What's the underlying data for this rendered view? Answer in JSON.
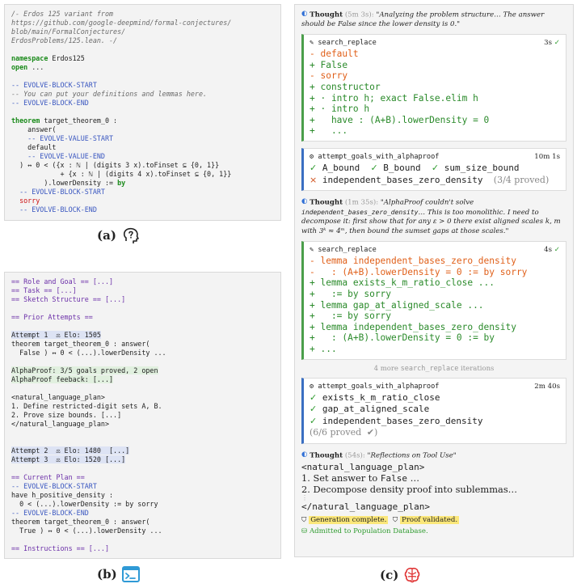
{
  "panel_a": {
    "lines": [
      {
        "cls": "comment",
        "text": "/- Erdos 125 variant from"
      },
      {
        "cls": "comment",
        "text": "https://github.com/google-deepmind/formal-conjectures/"
      },
      {
        "cls": "comment",
        "text": "blob/main/FormalConjectures/"
      },
      {
        "cls": "comment",
        "text": "ErdosProblems/125.lean. -/"
      },
      {
        "cls": "",
        "text": ""
      },
      {
        "cls": "kw-line",
        "kw": "namespace",
        "text": " Erdos125"
      },
      {
        "cls": "kw-line",
        "kw": "open",
        "text": " ..."
      },
      {
        "cls": "",
        "text": ""
      },
      {
        "cls": "evolve",
        "text": "-- EVOLVE-BLOCK-START"
      },
      {
        "cls": "comment",
        "text": "-- You can put your definitions and lemmas here."
      },
      {
        "cls": "evolve",
        "text": "-- EVOLVE-BLOCK-END"
      },
      {
        "cls": "",
        "text": ""
      },
      {
        "cls": "kw-line",
        "kw": "theorem",
        "text": " target_theorem_0 :"
      },
      {
        "cls": "",
        "text": "    answer("
      },
      {
        "cls": "evolve",
        "text": "    -- EVOLVE-VALUE-START"
      },
      {
        "cls": "",
        "text": "    default"
      },
      {
        "cls": "evolve",
        "text": "    -- EVOLVE-VALUE-END"
      },
      {
        "cls": "",
        "text": "  ) ↔ 0 < ({x : ℕ | (digits 3 x).toFinset ⊆ {0, 1}}"
      },
      {
        "cls": "",
        "text": "            + {x : ℕ | (digits 4 x).toFinset ⊆ {0, 1}}"
      },
      {
        "cls": "kw-tail",
        "text": "        ).lowerDensity := ",
        "kw": "by"
      },
      {
        "cls": "evolve",
        "text": "  -- EVOLVE-BLOCK-START"
      },
      {
        "cls": "red",
        "text": "  sorry"
      },
      {
        "cls": "evolve",
        "text": "  -- EVOLVE-BLOCK-END"
      }
    ]
  },
  "caption_a": "(a)",
  "panel_b": {
    "lines": [
      {
        "cls": "purple",
        "text": "== Role and Goal == [...]"
      },
      {
        "cls": "purple",
        "text": "== Task == [...]"
      },
      {
        "cls": "purple",
        "text": "== Sketch Structure == [...]"
      },
      {
        "cls": "",
        "text": ""
      },
      {
        "cls": "purple",
        "text": "== Prior Attempts =="
      },
      {
        "cls": "",
        "text": ""
      },
      {
        "cls": "hl-blue",
        "text": "Attempt 1  ⚖ Elo: 1505"
      },
      {
        "cls": "",
        "text": "theorem target_theorem_0 : answer("
      },
      {
        "cls": "",
        "text": "  False ) ↔ 0 < (...).lowerDensity ..."
      },
      {
        "cls": "",
        "text": ""
      },
      {
        "cls": "hl-green",
        "text": "AlphaProof: 3/5 goals proved, 2 open"
      },
      {
        "cls": "hl-green",
        "text": "AlphaProof feeback: [...]"
      },
      {
        "cls": "",
        "text": ""
      },
      {
        "cls": "",
        "text": "<natural_language_plan>"
      },
      {
        "cls": "",
        "text": "1. Define restricted-digit sets A, B."
      },
      {
        "cls": "",
        "text": "2. Prove size bounds. [...]"
      },
      {
        "cls": "",
        "text": "</natural_language_plan>"
      },
      {
        "cls": "",
        "text": ""
      },
      {
        "cls": "",
        "text": ""
      },
      {
        "cls": "hl-blue",
        "text": "Attempt 2  ⚖ Elo: 1480  [...]"
      },
      {
        "cls": "hl-blue",
        "text": "Attempt 3  ⚖ Elo: 1520 [...]"
      },
      {
        "cls": "",
        "text": ""
      },
      {
        "cls": "purple",
        "text": "== Current Plan =="
      },
      {
        "cls": "evolve",
        "text": "-- EVOLVE-BLOCK-START"
      },
      {
        "cls": "",
        "text": "have h_positive_density :"
      },
      {
        "cls": "",
        "text": "  0 < (...).lowerDensity := by sorry"
      },
      {
        "cls": "evolve",
        "text": "-- EVOLVE-BLOCK-END"
      },
      {
        "cls": "",
        "text": "theorem target_theorem_0 : answer("
      },
      {
        "cls": "",
        "text": "  True ) ↔ 0 < (...).lowerDensity ..."
      },
      {
        "cls": "",
        "text": ""
      },
      {
        "cls": "purple",
        "text": "== Instructions == [...]"
      }
    ]
  },
  "caption_b": "(b)",
  "caption_c": "(c)",
  "panel_c": {
    "thought1": {
      "label": "Thought",
      "time": "(5m 3s):",
      "text": "\"Analyzing the problem structure… The answer should be False since the lower density is 0.\""
    },
    "sr1": {
      "title": "search_replace",
      "time": "3s",
      "lines": [
        {
          "sign": "-",
          "text": " default"
        },
        {
          "sign": "+",
          "text": " False"
        },
        {
          "sign": "-",
          "text": " sorry"
        },
        {
          "sign": "+",
          "text": " constructor"
        },
        {
          "sign": "+",
          "text": " · intro h; exact False.elim h"
        },
        {
          "sign": "+",
          "text": " · intro h"
        },
        {
          "sign": "+",
          "text": "   have : (A+B).lowerDensity = 0"
        },
        {
          "sign": "+",
          "text": "   ..."
        }
      ]
    },
    "ag1": {
      "title": "attempt_goals_with_alphaproof",
      "time": "10m 1s",
      "goals_row": [
        "A_bound",
        "B_bound",
        "sum_size_bound"
      ],
      "failed": "independent_bases_zero_density",
      "summary": "(3/4 proved)"
    },
    "thought2": {
      "label": "Thought",
      "time": "(1m 35s):",
      "text_before": "\"AlphaProof couldn't solve ",
      "code": "independent_bases_zero_density",
      "text_after": "… This is too monolithic. I need to decompose it: first show that for any ε > 0 there exist aligned scales k, m with 3ᵏ ≈ 4ᵐ, then bound the sumset gaps at those scales.\""
    },
    "sr2": {
      "title": "search_replace",
      "time": "4s",
      "lines": [
        {
          "sign": "-",
          "text": " lemma independent_bases_zero_density"
        },
        {
          "sign": "-",
          "text": "   : (A+B).lowerDensity = 0 := by sorry"
        },
        {
          "sign": "+",
          "text": " lemma exists_k_m_ratio_close ..."
        },
        {
          "sign": "+",
          "text": "   := by sorry"
        },
        {
          "sign": "+",
          "text": " lemma gap_at_aligned_scale ..."
        },
        {
          "sign": "+",
          "text": "   := by sorry"
        },
        {
          "sign": "+",
          "text": " lemma independent_bases_zero_density"
        },
        {
          "sign": "+",
          "text": "   : (A+B).lowerDensity = 0 := by"
        },
        {
          "sign": "+",
          "text": " ..."
        }
      ]
    },
    "iter_note_prefix": "4 more",
    "iter_note_code": "search_replace",
    "iter_note_suffix": "iterations",
    "ag2": {
      "title": "attempt_goals_with_alphaproof",
      "time": "2m 40s",
      "goals": [
        "exists_k_m_ratio_close",
        "gap_at_aligned_scale",
        "independent_bases_zero_density"
      ],
      "summary": "(6/6 proved"
    },
    "thought3": {
      "label": "Thought",
      "time": "(54s):",
      "text": "\"Reflections on Tool Use\""
    },
    "plan_open": "<natural_language_plan>",
    "plan_1_prefix": "1. Set answer to ",
    "plan_1_code": "False",
    "plan_1_suffix": " …",
    "plan_2": "2. Decompose density proof into sublemmas…",
    "plan_close": "</natural_language_plan>",
    "tag_generation": "Generation complete.",
    "tag_proof": "Proof validated.",
    "admitted": "Admitted to Population Database."
  }
}
